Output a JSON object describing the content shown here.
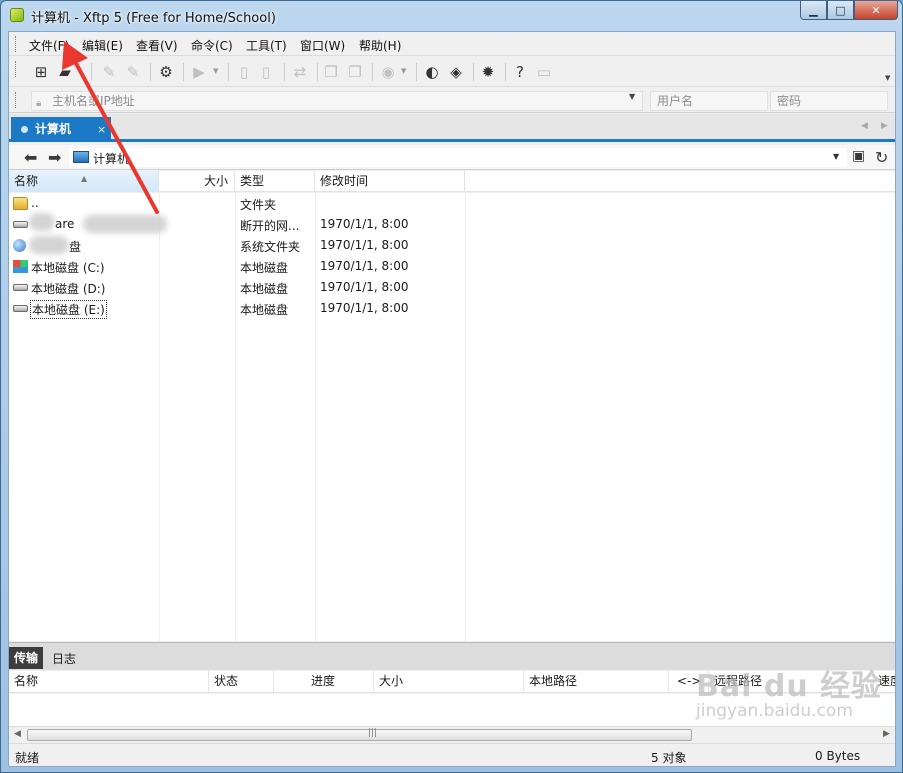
{
  "window": {
    "title": "计算机 - Xftp 5 (Free for Home/School)",
    "controls": {
      "minimize": "▁",
      "maximize": "□",
      "close": "✕"
    }
  },
  "menu": [
    "文件(F)",
    "编辑(E)",
    "查看(V)",
    "命令(C)",
    "工具(T)",
    "窗口(W)",
    "帮助(H)"
  ],
  "address_bar": {
    "host_placeholder": "主机名或IP地址",
    "user_placeholder": "用户名",
    "password_placeholder": "密码"
  },
  "tab": {
    "label": "计算机",
    "close": "×"
  },
  "path": {
    "current": "计算机"
  },
  "file_list": {
    "columns": {
      "name": "名称",
      "size": "大小",
      "type": "类型",
      "modified": "修改时间"
    },
    "rows": [
      {
        "name": "..",
        "type": "文件夹",
        "modified": "",
        "icon": "folder-icon"
      },
      {
        "name": "are",
        "type": "断开的网...",
        "modified": "1970/1/1, 8:00",
        "icon": "network-drive-icon"
      },
      {
        "name": "盘",
        "type": "系统文件夹",
        "modified": "1970/1/1, 8:00",
        "icon": "network-icon"
      },
      {
        "name": "本地磁盘 (C:)",
        "type": "本地磁盘",
        "modified": "1970/1/1, 8:00",
        "icon": "windows-drive-icon"
      },
      {
        "name": "本地磁盘 (D:)",
        "type": "本地磁盘",
        "modified": "1970/1/1, 8:00",
        "icon": "drive-icon"
      },
      {
        "name": "本地磁盘 (E:)",
        "type": "本地磁盘",
        "modified": "1970/1/1, 8:00",
        "icon": "drive-icon"
      }
    ]
  },
  "panel": {
    "tabs": {
      "transfer": "传输",
      "log": "日志"
    },
    "columns": {
      "name": "名称",
      "status": "状态",
      "progress": "进度",
      "size": "大小",
      "local_path": "本地路径",
      "direction": "<->",
      "remote_path": "远程路径",
      "speed": "速度"
    }
  },
  "scrollbar": {
    "grip": "|||"
  },
  "status": {
    "ready": "就绪",
    "objects": "5 对象",
    "bytes": "0 Bytes"
  },
  "watermark": {
    "logo": "Bai du 经验",
    "url": "jingyan.baidu.com"
  },
  "colors": {
    "accent": "#1c79c5",
    "annotation_arrow": "#e8382f"
  }
}
